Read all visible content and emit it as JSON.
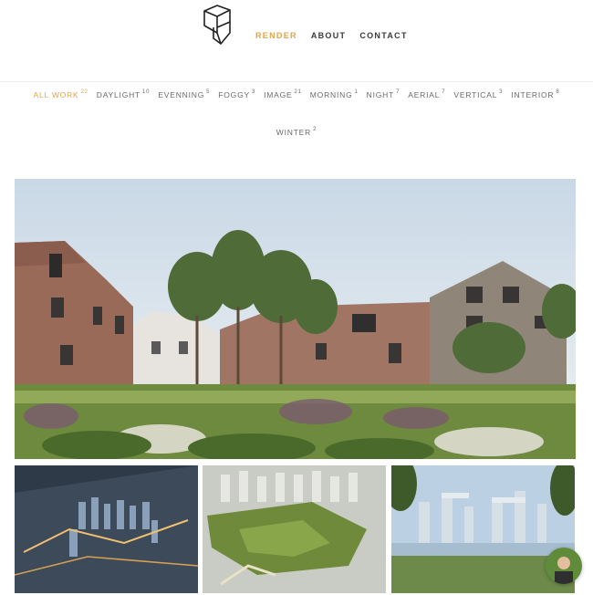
{
  "header": {
    "nav": [
      {
        "label": "RENDER",
        "active": true
      },
      {
        "label": "ABOUT",
        "active": false
      },
      {
        "label": "CONTACT",
        "active": false
      }
    ]
  },
  "filters": [
    {
      "label": "ALL WORK",
      "count": "22",
      "active": true
    },
    {
      "label": "DAYLIGHT",
      "count": "10",
      "active": false
    },
    {
      "label": "EVENNING",
      "count": "5",
      "active": false
    },
    {
      "label": "FOGGY",
      "count": "3",
      "active": false
    },
    {
      "label": "IMAGE",
      "count": "21",
      "active": false
    },
    {
      "label": "MORNING",
      "count": "1",
      "active": false
    },
    {
      "label": "NIGHT",
      "count": "7",
      "active": false
    },
    {
      "label": "AERIAL",
      "count": "7",
      "active": false
    },
    {
      "label": "VERTICAL",
      "count": "3",
      "active": false
    },
    {
      "label": "INTERIOR",
      "count": "8",
      "active": false
    },
    {
      "label": "WINTER",
      "count": "2",
      "active": false
    }
  ],
  "colors": {
    "accent": "#e0a44a",
    "text": "#3a3a3a",
    "muted": "#6a6a6a"
  },
  "gallery": [
    {
      "name": "hero-brick-housing-render"
    },
    {
      "name": "aerial-city-dusk-render"
    },
    {
      "name": "aerial-park-development-render"
    },
    {
      "name": "towers-lake-render"
    }
  ]
}
